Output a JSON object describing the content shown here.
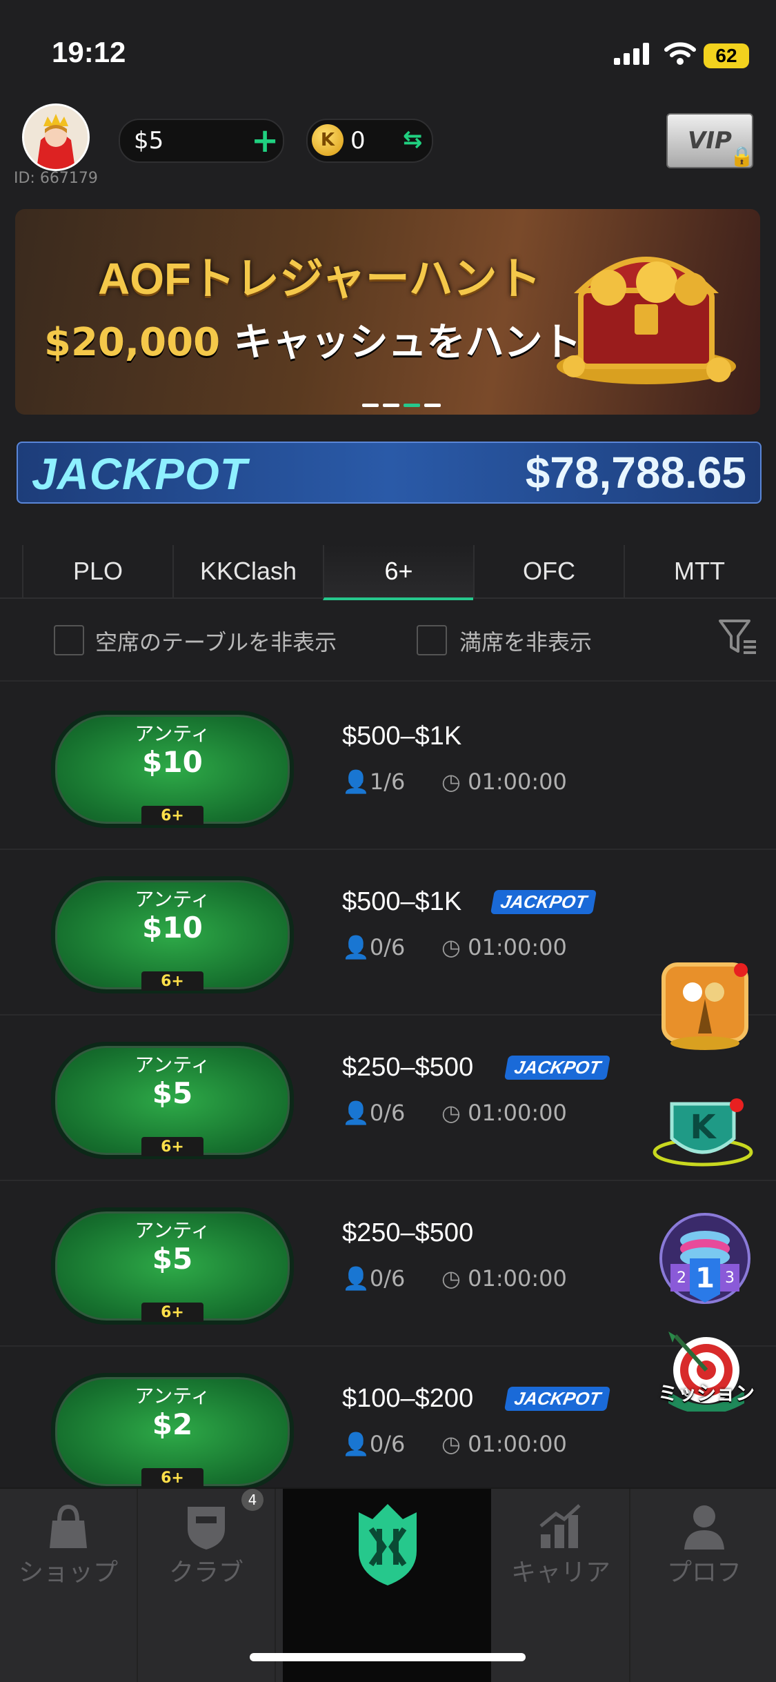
{
  "status_bar": {
    "time": "19:12",
    "battery": "62"
  },
  "header": {
    "user_id": "ID: 667179",
    "cash_balance": "$5",
    "coin_balance": "0",
    "coin_symbol": "K",
    "vip_label": "VIP"
  },
  "banner": {
    "title": "AOFトレジャーハント",
    "sub_amount": "$20,000",
    "sub_text": "キャッシュをハント!"
  },
  "jackpot": {
    "label": "JACKPOT",
    "value": "$78,788.65"
  },
  "tabs": [
    {
      "label": "PLO",
      "active": false
    },
    {
      "label": "KKClash",
      "active": false
    },
    {
      "label": "6+",
      "active": true
    },
    {
      "label": "OFC",
      "active": false
    },
    {
      "label": "MTT",
      "active": false
    }
  ],
  "filters": {
    "hide_empty": "空席のテーブルを非表示",
    "hide_full": "満席を非表示"
  },
  "tables": [
    {
      "ante_label": "アンティ",
      "ante": "$10",
      "badge": "6+",
      "stakes": "$500–$1K",
      "jackpot": "",
      "seats": "1/6",
      "timer": "01:00:00"
    },
    {
      "ante_label": "アンティ",
      "ante": "$10",
      "badge": "6+",
      "stakes": "$500–$1K",
      "jackpot": "JACKPOT",
      "seats": "0/6",
      "timer": "01:00:00"
    },
    {
      "ante_label": "アンティ",
      "ante": "$5",
      "badge": "6+",
      "stakes": "$250–$500",
      "jackpot": "JACKPOT",
      "seats": "0/6",
      "timer": "01:00:00"
    },
    {
      "ante_label": "アンティ",
      "ante": "$5",
      "badge": "6+",
      "stakes": "$250–$500",
      "jackpot": "",
      "seats": "0/6",
      "timer": "01:00:00"
    },
    {
      "ante_label": "アンティ",
      "ante": "$2",
      "badge": "6+",
      "stakes": "$100–$200",
      "jackpot": "JACKPOT",
      "seats": "0/6",
      "timer": "01:00:00"
    }
  ],
  "floating": {
    "mission_label": "ミッション",
    "rank_number": "1",
    "rank_left": "2",
    "rank_right": "3",
    "kk_symbol": "K"
  },
  "bottom_nav": {
    "shop": "ショップ",
    "club": "クラブ",
    "club_badge": "4",
    "career": "キャリア",
    "profile": "プロフ"
  },
  "colors": {
    "accent": "#26c88c",
    "felt": "#1e8a3a",
    "jackpot_badge": "#1a6ad8"
  }
}
